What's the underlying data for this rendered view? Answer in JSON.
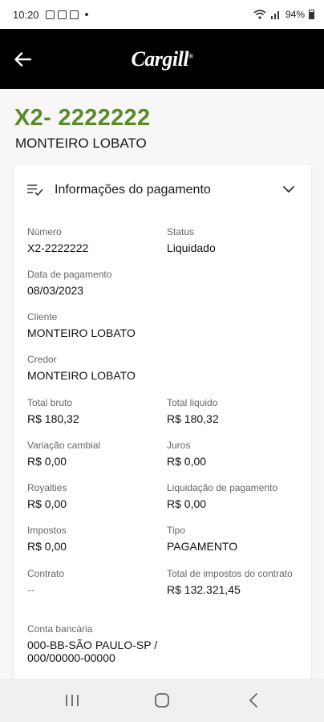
{
  "status_bar": {
    "time": "10:20",
    "battery": "94%"
  },
  "header": {
    "logo_text": "Cargill",
    "back_icon": "arrow-left-icon"
  },
  "record": {
    "number": "X2- 2222222",
    "name": "MONTEIRO LOBATO"
  },
  "payment_card": {
    "title": "Informações do pagamento",
    "fields": [
      {
        "label": "Número",
        "value": "X2-2222222"
      },
      {
        "label": "Status",
        "value": "Liquidado"
      },
      {
        "label": "Data de pagamento",
        "value": "08/03/2023"
      },
      {
        "label": "Cliente",
        "value": "MONTEIRO LOBATO"
      },
      {
        "label": "Credor",
        "value": "MONTEIRO LOBATO"
      },
      {
        "label": "Total bruto",
        "value": "R$ 180,32"
      },
      {
        "label": "Total liquido",
        "value": "R$ 180,32"
      },
      {
        "label": "Variação cambial",
        "value": "R$ 0,00"
      },
      {
        "label": "Juros",
        "value": "R$ 0,00"
      },
      {
        "label": "Royalties",
        "value": "R$ 0,00"
      },
      {
        "label": "Liquidação de pagamento",
        "value": "R$ 0,00"
      },
      {
        "label": "Impostos",
        "value": "R$ 0,00"
      },
      {
        "label": "Tipo",
        "value": "PAGAMENTO"
      },
      {
        "label": "Contrato",
        "value": "--"
      },
      {
        "label": "Total de impostos do contrato",
        "value": "R$ 132.321,45"
      },
      {
        "label": "Conta bancária",
        "value": "000-BB-SÃO PAULO-SP / 000/00000-00000"
      }
    ]
  },
  "colors": {
    "accent_green": "#5a8a28",
    "header_bg": "#000000"
  }
}
